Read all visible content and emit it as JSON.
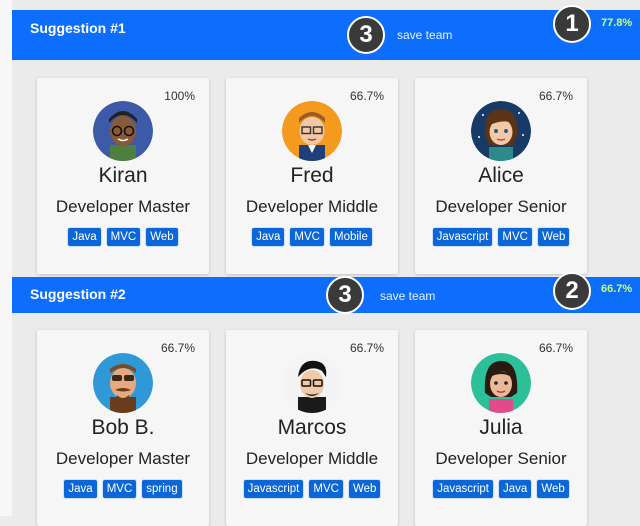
{
  "suggestions": [
    {
      "title": "Suggestion #1",
      "step_badge": "3",
      "save_label": "save team",
      "rank_badge": "1",
      "score": "77.8%",
      "members": [
        {
          "percent": "100%",
          "name": "Kiran",
          "role": "Developer Master",
          "tags": [
            "Java",
            "MVC",
            "Web"
          ]
        },
        {
          "percent": "66.7%",
          "name": "Fred",
          "role": "Developer Middle",
          "tags": [
            "Java",
            "MVC",
            "Mobile"
          ]
        },
        {
          "percent": "66.7%",
          "name": "Alice",
          "role": "Developer Senior",
          "tags": [
            "Javascript",
            "MVC",
            "Web"
          ]
        }
      ]
    },
    {
      "title": "Suggestion #2",
      "step_badge": "3",
      "save_label": "save team",
      "rank_badge": "2",
      "score": "66.7%",
      "members": [
        {
          "percent": "66.7%",
          "name": "Bob B.",
          "role": "Developer Master",
          "tags": [
            "Java",
            "MVC",
            "spring"
          ]
        },
        {
          "percent": "66.7%",
          "name": "Marcos",
          "role": "Developer Middle",
          "tags": [
            "Javascript",
            "MVC",
            "Web"
          ]
        },
        {
          "percent": "66.7%",
          "name": "Julia",
          "role": "Developer Senior",
          "tags": [
            "Javascript",
            "Java",
            "Web"
          ]
        }
      ]
    }
  ],
  "colors": {
    "bar": "#0d6efd",
    "tag": "#0b67d8",
    "score": "#c6ff7a",
    "badge": "#3a3a3a"
  },
  "icons": [
    "kiran-avatar-icon",
    "fred-avatar-icon",
    "alice-avatar-icon",
    "bob-avatar-icon",
    "marcos-avatar-icon",
    "julia-avatar-icon"
  ]
}
